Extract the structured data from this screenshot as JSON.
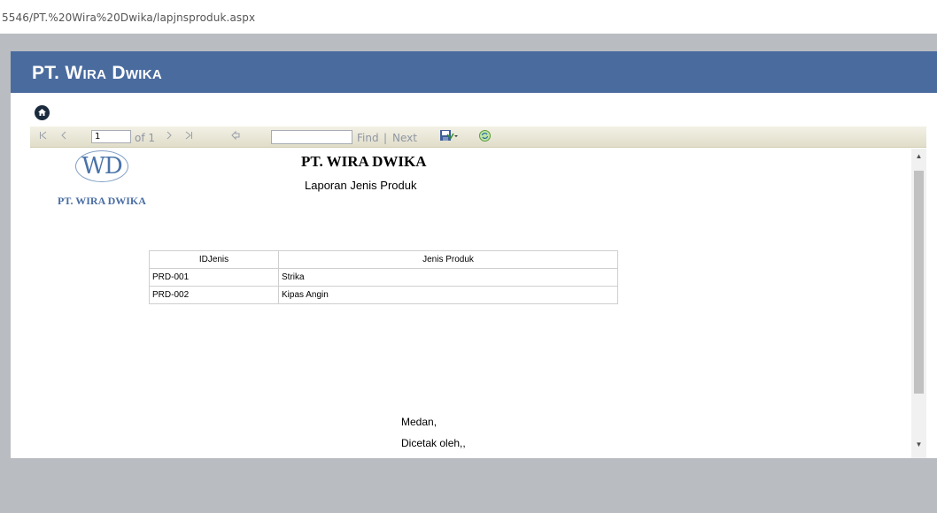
{
  "browser": {
    "url": "5546/PT.%20Wira%20Dwika/lapjnsproduk.aspx"
  },
  "header": {
    "brand": "PT. Wira Dwika"
  },
  "toolbar": {
    "page_value": "1",
    "page_of": "of 1",
    "find_label": "Find",
    "separator": "|",
    "next_label": "Next"
  },
  "report": {
    "logo_text": "WD",
    "logo_name": "PT. WIRA DWIKA",
    "title": "PT. WIRA DWIKA",
    "subtitle": "Laporan Jenis Produk",
    "table": {
      "headers": [
        "IDJenis",
        "Jenis Produk"
      ],
      "rows": [
        [
          "PRD-001",
          "Strika"
        ],
        [
          "PRD-002",
          "Kipas Angin"
        ]
      ]
    },
    "footer_city": "Medan,",
    "footer_printed_by": "Dicetak oleh,,"
  },
  "colors": {
    "header_bg": "#4a6b9e",
    "toolbar_bg": "#e0ddc9",
    "page_bg": "#b9bcc1"
  }
}
